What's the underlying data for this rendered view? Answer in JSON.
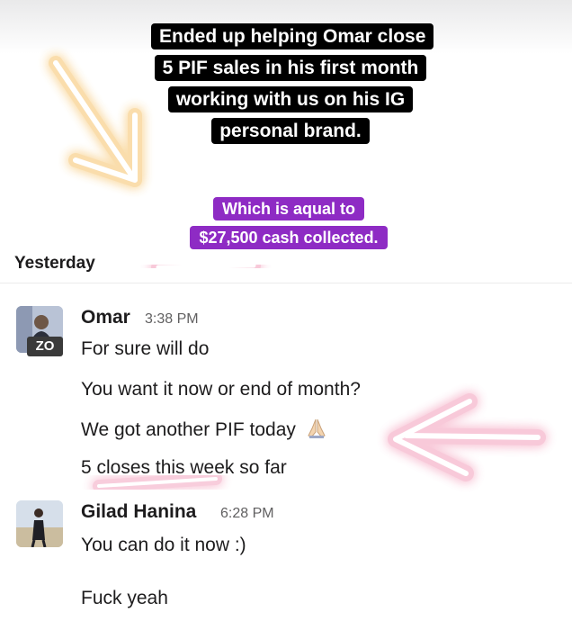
{
  "story": {
    "caption": "Ended up helping Omar close 5 PIF sales in his first month working with us on his IG personal brand.",
    "promo_line1": "Which is aqual to",
    "promo_line2": "$27,500 cash collected."
  },
  "divider": {
    "label": "Yesterday"
  },
  "messages": [
    {
      "author": "Omar",
      "time": "3:38 PM",
      "badge": "ZO",
      "lines": [
        "For sure will do",
        "You want it now or end of month?",
        "We got another PIF today",
        "5 closes this week so far"
      ],
      "emoji_icon": "folded-hands-icon"
    },
    {
      "author": "Gilad Hanina",
      "time": "6:28 PM",
      "lines": [
        "You can do it now :)",
        "Fuck yeah"
      ]
    }
  ],
  "colors": {
    "caption_bg": "#000000",
    "promo_bg": "#8e2bc4",
    "glow": "#f4a6c0",
    "arrow_glow": "#f6c36b"
  }
}
